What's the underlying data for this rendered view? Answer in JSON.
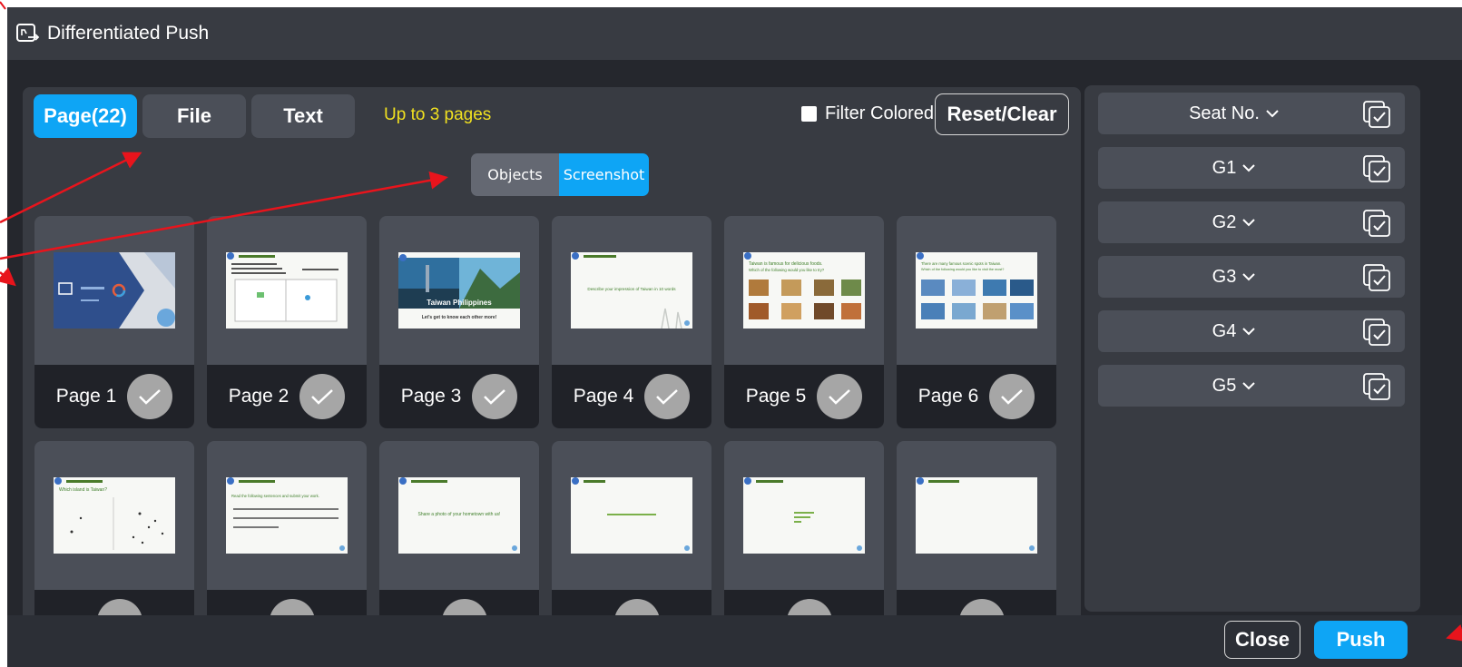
{
  "window": {
    "title": "Differentiated Push",
    "title_icon": "push-window-icon"
  },
  "tabs": [
    {
      "label": "Page(22)",
      "active": true
    },
    {
      "label": "File",
      "active": false
    },
    {
      "label": "Text",
      "active": false
    }
  ],
  "hint": "Up to 3 pages",
  "filter": {
    "label": "Filter Colored",
    "checked": false
  },
  "reset_button": "Reset/Clear",
  "view_toggle": {
    "objects": "Objects",
    "screenshot": "Screenshot",
    "selected": "Screenshot"
  },
  "pages": [
    {
      "label": "Page 1",
      "thumb": "cover"
    },
    {
      "label": "Page 2",
      "thumb": "join-class"
    },
    {
      "label": "Page 3",
      "thumb": "taiwan-philippines"
    },
    {
      "label": "Page 4",
      "thumb": "cloze"
    },
    {
      "label": "Page 5",
      "thumb": "foods"
    },
    {
      "label": "Page 6",
      "thumb": "scenic-spots"
    },
    {
      "label": "",
      "thumb": "map"
    },
    {
      "label": "",
      "thumb": "audio-task"
    },
    {
      "label": "",
      "thumb": "picture-task"
    },
    {
      "label": "",
      "thumb": "sticky-note"
    },
    {
      "label": "",
      "thumb": "speaking"
    },
    {
      "label": "",
      "thumb": "assessment"
    }
  ],
  "thumb_text": {
    "page3_banner": "Taiwan  Philippines",
    "page3_caption": "Let's get to know each other more!",
    "page4_caption": "Describe your impression of Taiwan in 10 words",
    "page5_title": "Taiwan is famous for delicious foods.",
    "page5_subtitle": "Which of the following would you like to try?",
    "page6_title": "There are many famous scenic spots in Taiwan.",
    "page6_subtitle": "Which of the following would you like to visit the most?",
    "page7_title": "Which island is Taiwan?",
    "page8_title": "Read the following sentences and submit your work.",
    "page9_caption": "Share a photo of your hometown with us!"
  },
  "groups": [
    {
      "label": "Seat No."
    },
    {
      "label": "G1"
    },
    {
      "label": "G2"
    },
    {
      "label": "G3"
    },
    {
      "label": "G4"
    },
    {
      "label": "G5"
    }
  ],
  "footer": {
    "close": "Close",
    "push": "Push"
  },
  "colors": {
    "accent": "#0ea5f5",
    "hint": "#f0e020",
    "annotation_arrows": "#e8141c"
  }
}
